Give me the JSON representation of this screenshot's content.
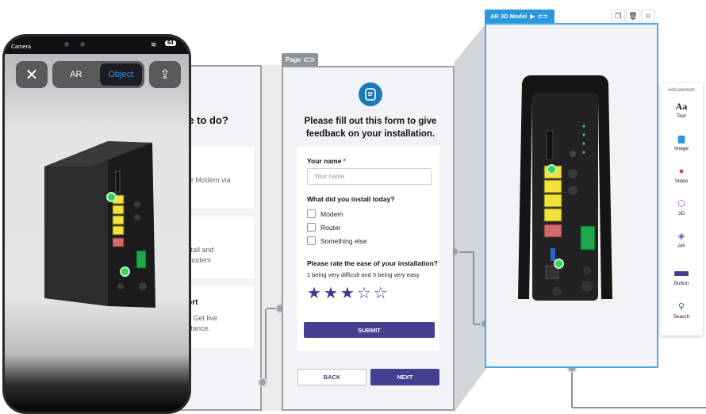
{
  "back_page": {
    "title": "ke to do?",
    "cards": [
      {
        "lines": [
          "ur Modem via"
        ]
      },
      {
        "lines": [
          "e",
          "stall and",
          "modem"
        ]
      },
      {
        "lines": [
          "",
          "? Get live",
          "stance."
        ]
      }
    ],
    "support_label": "port"
  },
  "page_tab": {
    "label": "Page"
  },
  "form": {
    "heading": "Please fill out this form to give feedback on your installation.",
    "name_label": "Your name",
    "required_mark": "*",
    "name_placeholder": "Your name",
    "install_question": "What did you install today?",
    "options": [
      "Modem",
      "Router",
      "Something else"
    ],
    "rating_question": "Please rate the ease of your installation?",
    "rating_hint": "1 being very difficult and 5 being very easy",
    "rating_value": 3,
    "rating_max": 5,
    "submit_label": "SUBMIT",
    "back_label": "BACK",
    "next_label": "NEXT"
  },
  "ar_tab": {
    "label": "AR 3D Model"
  },
  "ar_tools": [
    "copy-icon",
    "trash-icon",
    "crop-icon"
  ],
  "palette": {
    "title": "Add element",
    "items": [
      {
        "label": "Text",
        "icon": "Aa"
      },
      {
        "label": "Image",
        "icon": "image-icon"
      },
      {
        "label": "Video",
        "icon": "video-icon"
      },
      {
        "label": "3D",
        "icon": "3d-icon"
      },
      {
        "label": "AR",
        "icon": "ar-icon"
      },
      {
        "label": "Button",
        "icon": "button-icon"
      },
      {
        "label": "Search",
        "icon": "search-icon"
      }
    ]
  },
  "phone": {
    "status_left": "Camera",
    "battery": "64",
    "modes": [
      "AR",
      "Object"
    ],
    "active_mode": "Object"
  },
  "colors": {
    "accent_purple": "#443f8f",
    "accent_blue": "#2b97dd",
    "form_icon": "#1a7ab8",
    "hotspot_green": "#39d15a",
    "port_yellow": "#f2e23b"
  }
}
